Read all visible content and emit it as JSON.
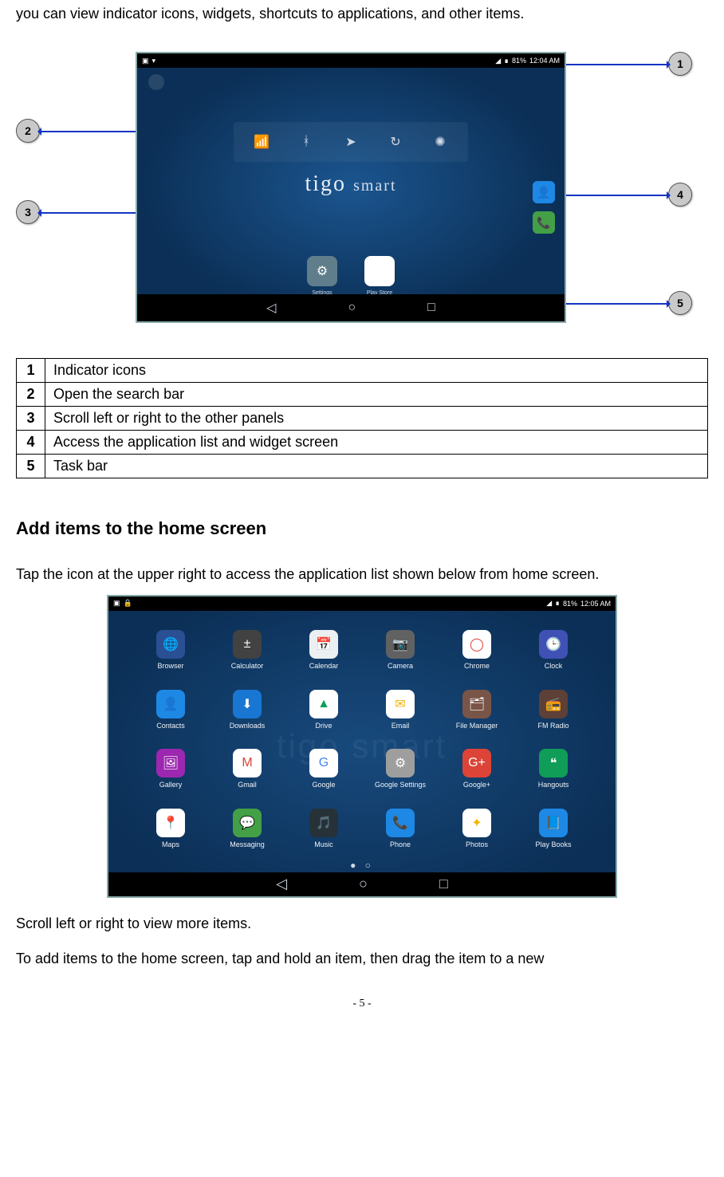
{
  "intro_text": "you can view indicator icons, widgets, shortcuts to applications, and other items.",
  "home_screen": {
    "status": {
      "battery": "81%",
      "time": "12:04 AM"
    },
    "brand_main": "tigo",
    "brand_sub": "smart",
    "bottom_apps": {
      "settings": "Settings",
      "play": "Play Store"
    }
  },
  "callouts": [
    {
      "num": "1",
      "desc": "Indicator icons"
    },
    {
      "num": "2",
      "desc": "Open the search bar"
    },
    {
      "num": "3",
      "desc": "Scroll left or right to the other panels"
    },
    {
      "num": "4",
      "desc": "Access the application list and widget screen"
    },
    {
      "num": "5",
      "desc": "Task bar"
    }
  ],
  "section_heading": "Add items to the home screen",
  "section_para1": "Tap the icon at the upper right to access the application list shown below from home screen.",
  "apps_screen": {
    "status": {
      "battery": "81%",
      "time": "12:05 AM"
    },
    "apps": [
      {
        "name": "Browser",
        "bg": "#2b4f93",
        "glyph": "🌐"
      },
      {
        "name": "Calculator",
        "bg": "#424242",
        "glyph": "±"
      },
      {
        "name": "Calendar",
        "bg": "#eceff1",
        "glyph": "📅",
        "fg": "#333"
      },
      {
        "name": "Camera",
        "bg": "#616161",
        "glyph": "📷"
      },
      {
        "name": "Chrome",
        "bg": "#ffffff",
        "glyph": "◯",
        "fg": "#db4437"
      },
      {
        "name": "Clock",
        "bg": "#3f51b5",
        "glyph": "🕒"
      },
      {
        "name": "Contacts",
        "bg": "#1e88e5",
        "glyph": "👤"
      },
      {
        "name": "Downloads",
        "bg": "#1976d2",
        "glyph": "⬇"
      },
      {
        "name": "Drive",
        "bg": "#ffffff",
        "glyph": "▲",
        "fg": "#0f9d58"
      },
      {
        "name": "Email",
        "bg": "#ffffff",
        "glyph": "✉",
        "fg": "#f4b400"
      },
      {
        "name": "File Manager",
        "bg": "#795548",
        "glyph": "🗂"
      },
      {
        "name": "FM Radio",
        "bg": "#5d4037",
        "glyph": "📻"
      },
      {
        "name": "Gallery",
        "bg": "#9c27b0",
        "glyph": "🖼"
      },
      {
        "name": "Gmail",
        "bg": "#ffffff",
        "glyph": "M",
        "fg": "#db4437"
      },
      {
        "name": "Google",
        "bg": "#ffffff",
        "glyph": "G",
        "fg": "#4285F4"
      },
      {
        "name": "Google Settings",
        "bg": "#9e9e9e",
        "glyph": "⚙"
      },
      {
        "name": "Google+",
        "bg": "#db4437",
        "glyph": "G+"
      },
      {
        "name": "Hangouts",
        "bg": "#0f9d58",
        "glyph": "❝"
      },
      {
        "name": "Maps",
        "bg": "#ffffff",
        "glyph": "📍",
        "fg": "#0f9d58"
      },
      {
        "name": "Messaging",
        "bg": "#43a047",
        "glyph": "💬"
      },
      {
        "name": "Music",
        "bg": "#263238",
        "glyph": "🎵"
      },
      {
        "name": "Phone",
        "bg": "#1e88e5",
        "glyph": "📞"
      },
      {
        "name": "Photos",
        "bg": "#ffffff",
        "glyph": "✦",
        "fg": "#f4b400"
      },
      {
        "name": "Play Books",
        "bg": "#1e88e5",
        "glyph": "📘"
      }
    ]
  },
  "after_apps_1": "Scroll left or right to view more items.",
  "after_apps_2": "To add items to the home screen, tap and hold an item, then drag the item to a new",
  "page_number": "- 5 -"
}
